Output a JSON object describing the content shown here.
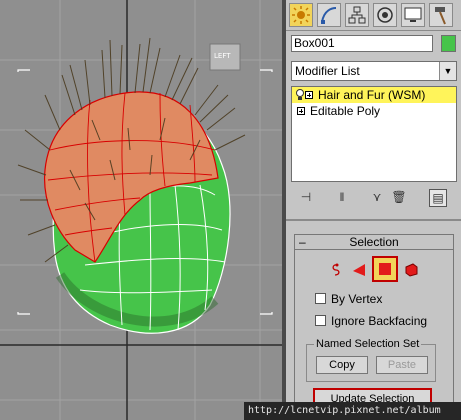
{
  "viewport": {
    "label": "LEFT",
    "colors": {
      "background": "#8f8f8f",
      "mesh": "#46c44a",
      "fur_region": "#e08a62",
      "hair": "#4a3a1e"
    }
  },
  "command_panel": {
    "tabs": [
      {
        "name": "create",
        "icon": "sun-icon",
        "active": true
      },
      {
        "name": "modify",
        "icon": "modify-curve-icon",
        "active": false
      },
      {
        "name": "hierarchy",
        "icon": "hierarchy-icon",
        "active": false
      },
      {
        "name": "motion",
        "icon": "motion-icon",
        "active": false
      },
      {
        "name": "display",
        "icon": "display-monitor-icon",
        "active": false
      },
      {
        "name": "utilities",
        "icon": "hammer-icon",
        "active": false
      }
    ],
    "object_name": "Box001",
    "object_color": "#46c44a",
    "modifier_list": "Modifier List",
    "stack": [
      {
        "label": "Hair and Fur (WSM)",
        "selected": true
      },
      {
        "label": "Editable Poly",
        "selected": false
      }
    ],
    "selection_rollout": {
      "title": "Selection",
      "by_vertex": "By Vertex",
      "ignore_backfacing": "Ignore Backfacing",
      "named_set_title": "Named Selection Set",
      "copy": "Copy",
      "paste": "Paste",
      "update_selection": "Update Selection"
    }
  },
  "footer": {
    "watermark": "http://lcnetvip.pixnet.net/album"
  }
}
